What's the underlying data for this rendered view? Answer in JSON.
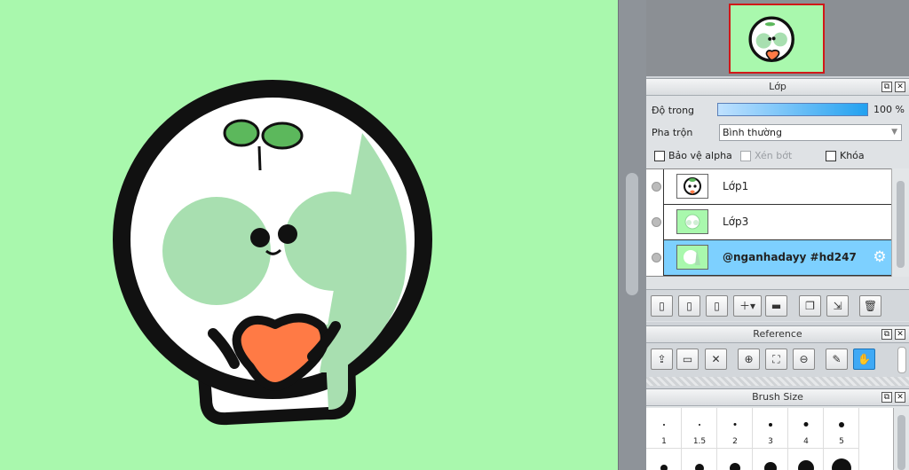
{
  "colors": {
    "canvas_bg": "#a9f8ad",
    "outline": "#111111",
    "face": "#ffffff",
    "cheek": "#a8dfb0",
    "shade": "#a8dfb0",
    "sprout": "#5cb85c",
    "heart": "#ff7a45",
    "selected_layer": "#7dd0ff",
    "opacity_fill": "#22a1f0",
    "accent_button": "#3fa9f5"
  },
  "layer_panel": {
    "title": "Lớp",
    "opacity_label": "Độ trong",
    "opacity_value": "100 %",
    "opacity": 1.0,
    "blend_label": "Pha trộn",
    "blend_value": "Bình thường",
    "checkboxes": [
      {
        "label": "Bảo vệ alpha",
        "checked": false,
        "enabled": true
      },
      {
        "label": "Xén bớt",
        "checked": false,
        "enabled": false
      },
      {
        "label": "Khóa",
        "checked": false,
        "enabled": true
      }
    ],
    "layers": [
      {
        "name": "Lớp1",
        "selected": false
      },
      {
        "name": "Lớp3",
        "selected": false
      },
      {
        "name": "@nganhadayy #hd247",
        "selected": true
      }
    ]
  },
  "reference_panel": {
    "title": "Reference"
  },
  "brush_panel": {
    "title": "Brush Size",
    "sizes": [
      "1",
      "1.5",
      "2",
      "3",
      "4",
      "5"
    ]
  },
  "header_buttons": {
    "float": "⧉",
    "close": "✕"
  }
}
